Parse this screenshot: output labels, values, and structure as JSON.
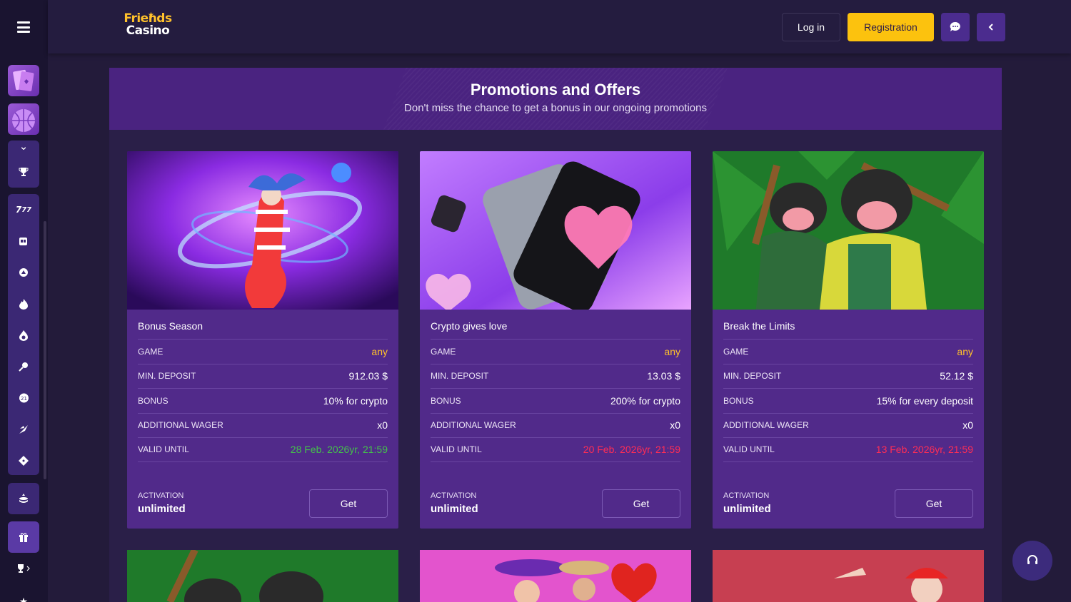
{
  "header": {
    "logo_line1": "Friends",
    "logo_line2": "Casino",
    "login_label": "Log in",
    "register_label": "Registration",
    "chat_icon": "chat-icon",
    "collapse_icon": "chevron-left-icon"
  },
  "sidebar": {
    "icons": [
      "cards-icon",
      "basketball-icon",
      "trophy-icon",
      "seven-icon",
      "slot-machine-icon",
      "rocket-icon",
      "fire-icon",
      "flame-icon",
      "pin-icon",
      "poker-chip-icon",
      "wings-icon",
      "ticket-icon",
      "coin-stack-icon",
      "gift-icon",
      "trophy-icon"
    ]
  },
  "banner": {
    "title": "Promotions and Offers",
    "subtitle": "Don't miss the chance to get a bonus in our ongoing promotions"
  },
  "labels": {
    "game": "GAME",
    "min_deposit": "MIN. DEPOSIT",
    "bonus": "BONUS",
    "additional_wager": "ADDITIONAL WAGER",
    "valid_until": "VALID UNTIL",
    "activation": "ACTIVATION",
    "get": "Get"
  },
  "promos": [
    {
      "title": "Bonus Season",
      "game": "any",
      "min_deposit": "912.03 $",
      "bonus": "10% for crypto",
      "additional_wager": "x0",
      "valid_until": "28 Feb. 2026yr, 21:59",
      "valid_status": "green",
      "activation": "unlimited"
    },
    {
      "title": "Crypto gives love",
      "game": "any",
      "min_deposit": "13.03 $",
      "bonus": "200% for crypto",
      "additional_wager": "x0",
      "valid_until": "20 Feb. 2026yr, 21:59",
      "valid_status": "red",
      "activation": "unlimited"
    },
    {
      "title": "Break the Limits",
      "game": "any",
      "min_deposit": "52.12 $",
      "bonus": "15% for every deposit",
      "additional_wager": "x0",
      "valid_until": "13 Feb. 2026yr, 21:59",
      "valid_status": "red",
      "activation": "unlimited"
    }
  ],
  "colors": {
    "accent_yellow": "#fcc20e",
    "card_bg": "#512a8a",
    "green": "#44c14b",
    "red": "#ff2d55"
  },
  "support_icon": "headset-icon"
}
